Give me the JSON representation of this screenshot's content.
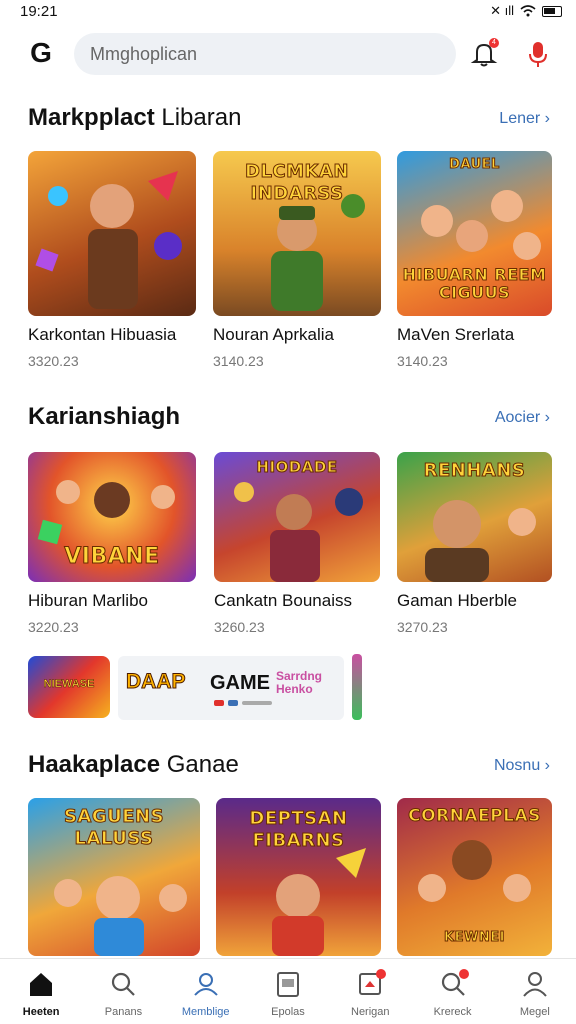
{
  "status": {
    "time": "19:21",
    "signal_text": "✕ ıll"
  },
  "search": {
    "placeholder": "Mmghoplican"
  },
  "sections": [
    {
      "title_bold": "Markpplact",
      "title_light": " Libaran",
      "more": "Lener",
      "cards": [
        {
          "title": "Karkontan Hibuasia",
          "meta": "3320.23",
          "thumb_text": ""
        },
        {
          "title": "Nouran Aprkalia",
          "meta": "3140.23",
          "thumb_text": "DLCMKAN INDARSS"
        },
        {
          "title": "MaVen Srerlata",
          "meta": "3140.23",
          "thumb_text": "HIBUARN REEM CIGUUS",
          "thumb_top": "DAUEL"
        }
      ]
    },
    {
      "title_bold": "Karianshiagh",
      "title_light": "",
      "more": "Aocier",
      "cards": [
        {
          "title": "Hiburan Marlibo",
          "meta": "3220.23",
          "thumb_text": "VIBANE"
        },
        {
          "title": "Cankatn Bounaiss",
          "meta": "3260.23",
          "thumb_text": "HIODADE"
        },
        {
          "title": "Gaman Hberble",
          "meta": "3270.23",
          "thumb_text": "RENHANS"
        }
      ]
    },
    {
      "title_bold": "Haakaplace",
      "title_light": " Ganae",
      "more": "Nosnu",
      "cards": [
        {
          "title": "",
          "meta": "",
          "thumb_text": "SAGUENS LALUSS"
        },
        {
          "title": "",
          "meta": "",
          "thumb_text": "DEPTSAN FIBARNS"
        },
        {
          "title": "",
          "meta": "",
          "thumb_text": "CORNAEPLAS",
          "thumb_bottom": "KEWNEI"
        }
      ]
    }
  ],
  "banner": {
    "left": "NIEWASE",
    "dapp": "DAAP",
    "game": "GAME",
    "side": "Sarrdng Henko"
  },
  "bottom_nav": [
    {
      "label": "Heeten",
      "icon": "home-icon"
    },
    {
      "label": "Panans",
      "icon": "search-icon"
    },
    {
      "label": "Memblige",
      "icon": "people-icon"
    },
    {
      "label": "Epolas",
      "icon": "tablet-icon"
    },
    {
      "label": "Nerigan",
      "icon": "notification-icon"
    },
    {
      "label": "Krereck",
      "icon": "search-badge-icon"
    },
    {
      "label": "Megel",
      "icon": "profile-icon"
    }
  ],
  "colors": {
    "accent": "#3a6fb5",
    "badge": "#e33333"
  }
}
